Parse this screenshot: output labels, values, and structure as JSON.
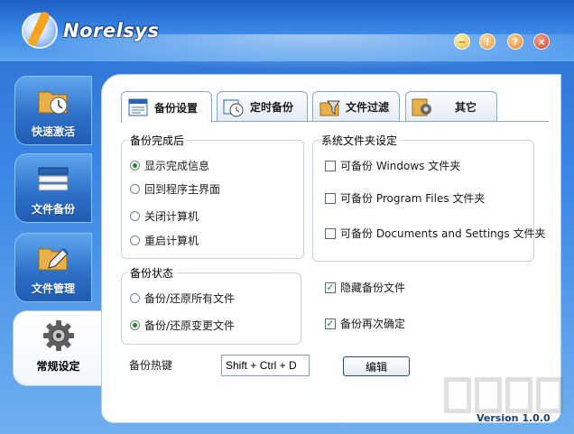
{
  "app": {
    "logo_text": "Norelsys",
    "version_text": "Version 1.0.0"
  },
  "window_buttons": {
    "minimize_glyph": "−",
    "warning_glyph": "!",
    "help_glyph": "?",
    "close_glyph": "×"
  },
  "sidebar": {
    "items": [
      {
        "label": "快速激活",
        "icon": "folder-clock-icon"
      },
      {
        "label": "文件备份",
        "icon": "stack-files-icon"
      },
      {
        "label": "文件管理",
        "icon": "folder-pen-icon"
      },
      {
        "label": "常规设定",
        "icon": "gear-icon",
        "active": true
      }
    ]
  },
  "tabs": [
    {
      "label": "备份设置",
      "icon": "document-icon",
      "active": true
    },
    {
      "label": "定时备份",
      "icon": "clock-icon"
    },
    {
      "label": "文件过滤",
      "icon": "funnel-icon"
    },
    {
      "label": "其它",
      "icon": "gear-icon"
    }
  ],
  "completion_group": {
    "legend": "备份完成后",
    "options": [
      {
        "label": "显示完成信息",
        "selected": true
      },
      {
        "label": "回到程序主界面",
        "selected": false
      },
      {
        "label": "关闭计算机",
        "selected": false
      },
      {
        "label": "重启计算机",
        "selected": false
      }
    ]
  },
  "status_group": {
    "legend": "备份状态",
    "options": [
      {
        "label": "备份/还原所有文件",
        "selected": false
      },
      {
        "label": "备份/还原变更文件",
        "selected": true
      }
    ]
  },
  "system_folders_group": {
    "legend": "系统文件夹设定",
    "options": [
      {
        "label": "可备份 Windows 文件夹",
        "checked": false
      },
      {
        "label": "可备份 Program Files 文件夹",
        "checked": false
      },
      {
        "label": "可备份 Documents and Settings 文件夹",
        "checked": false
      }
    ]
  },
  "extra_options": [
    {
      "label": "隐藏备份文件",
      "checked": true
    },
    {
      "label": "备份再次确定",
      "checked": true
    }
  ],
  "hotkey": {
    "label": "备份热键",
    "value": "Shift + Ctrl + D",
    "edit_label": "编辑"
  },
  "colors": {
    "accent_blue": "#2f72c9",
    "check_green": "#1f8a1f"
  }
}
